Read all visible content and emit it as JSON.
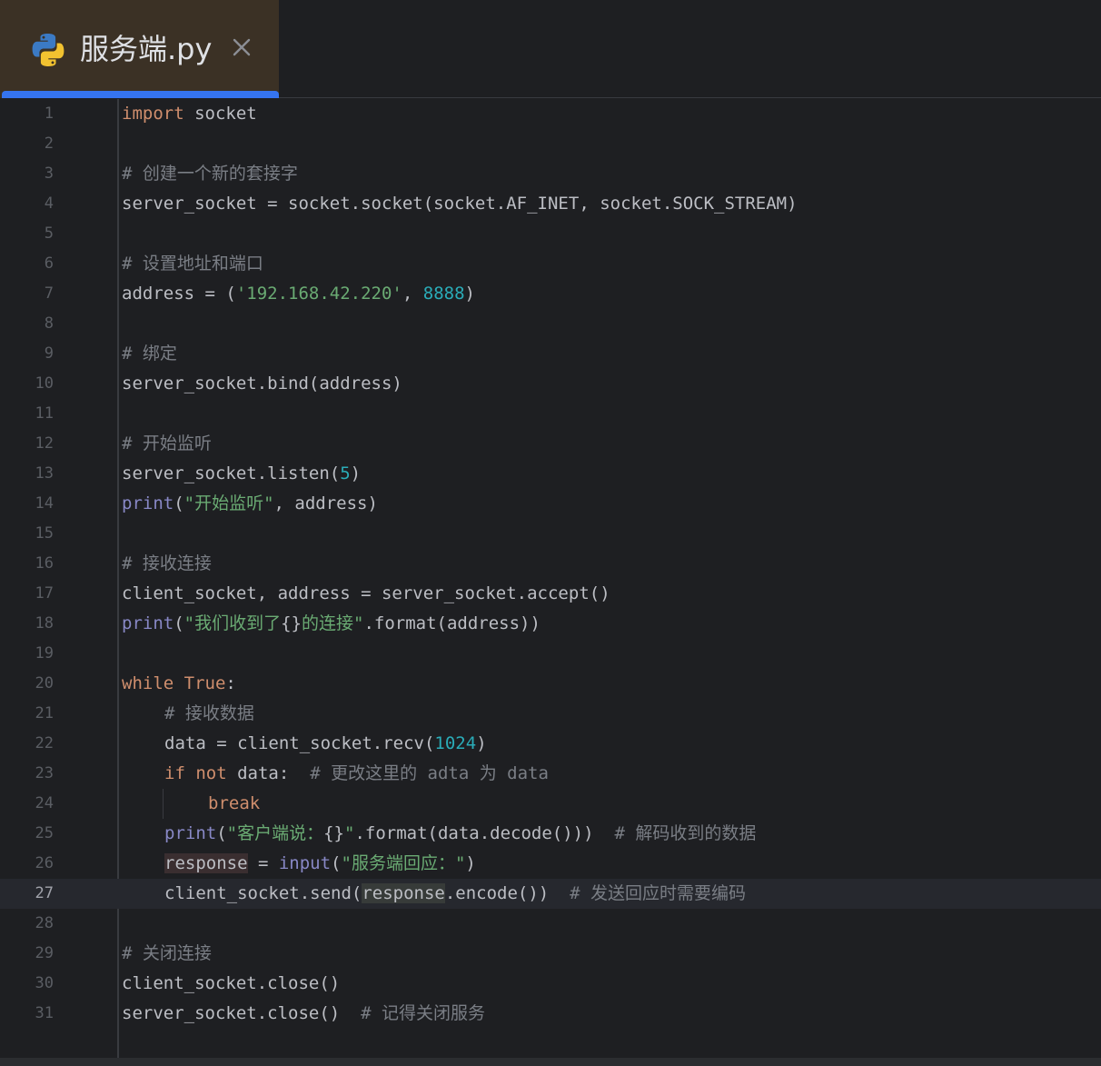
{
  "tab": {
    "title": "服务端.py",
    "icon": "python-icon",
    "close_icon": "close-icon",
    "accent": "#3574f0"
  },
  "editor": {
    "current_line": 27,
    "lines": [
      {
        "n": "1"
      },
      {
        "n": "2"
      },
      {
        "n": "3"
      },
      {
        "n": "4"
      },
      {
        "n": "5"
      },
      {
        "n": "6"
      },
      {
        "n": "7"
      },
      {
        "n": "8"
      },
      {
        "n": "9"
      },
      {
        "n": "10"
      },
      {
        "n": "11"
      },
      {
        "n": "12"
      },
      {
        "n": "13"
      },
      {
        "n": "14"
      },
      {
        "n": "15"
      },
      {
        "n": "16"
      },
      {
        "n": "17"
      },
      {
        "n": "18"
      },
      {
        "n": "19"
      },
      {
        "n": "20"
      },
      {
        "n": "21"
      },
      {
        "n": "22"
      },
      {
        "n": "23"
      },
      {
        "n": "24"
      },
      {
        "n": "25"
      },
      {
        "n": "26"
      },
      {
        "n": "27"
      },
      {
        "n": "28"
      },
      {
        "n": "29"
      },
      {
        "n": "30"
      },
      {
        "n": "31"
      }
    ],
    "code": {
      "l1": {
        "kw": "import",
        "rest": " socket"
      },
      "l3": {
        "cmt": "# 创建一个新的套接字"
      },
      "l4": {
        "text": "server_socket = socket.socket(socket.AF_INET, socket.SOCK_STREAM)"
      },
      "l6": {
        "cmt": "# 设置地址和端口"
      },
      "l7": {
        "a": "address = (",
        "str": "'192.168.42.220'",
        "b": ", ",
        "num": "8888",
        "c": ")"
      },
      "l9": {
        "cmt": "# 绑定"
      },
      "l10": {
        "text": "server_socket.bind(address)"
      },
      "l12": {
        "cmt": "# 开始监听"
      },
      "l13": {
        "a": "server_socket.listen(",
        "num": "5",
        "c": ")"
      },
      "l14": {
        "bi": "print",
        "a": "(",
        "str": "\"开始监听\"",
        "c": ", address)"
      },
      "l16": {
        "cmt": "# 接收连接"
      },
      "l17": {
        "text": "client_socket, address = server_socket.accept()"
      },
      "l18": {
        "bi": "print",
        "a": "(",
        "str1": "\"我们收到了",
        "brace": "{}",
        "str2": "的连接\"",
        "c": ".format(address))"
      },
      "l20": {
        "kw1": "while",
        "sp": " ",
        "kw2": "True",
        "c": ":"
      },
      "l21": {
        "cmt": "# 接收数据"
      },
      "l22": {
        "a": "data = client_socket.recv(",
        "num": "1024",
        "c": ")"
      },
      "l23": {
        "kw1": "if",
        "sp": " ",
        "kw2": "not",
        "a": " data:  ",
        "cmt": "# 更改这里的 adta 为 data"
      },
      "l24": {
        "kw": "break"
      },
      "l25": {
        "bi": "print",
        "a": "(",
        "str1": "\"客户端说：",
        "brace": "{}",
        "str2": "\"",
        "c": ".format(data.decode()))  ",
        "cmt": "# 解码收到的数据"
      },
      "l26": {
        "var": "response",
        "a": " = ",
        "bi": "input",
        "b": "(",
        "str": "\"服务端回应：\"",
        "c": ")"
      },
      "l27": {
        "a": "client_socket.send(",
        "var": "response",
        "c": ".encode())  ",
        "cmt": "# 发送回应时需要编码"
      },
      "l29": {
        "cmt": "# 关闭连接"
      },
      "l30": {
        "text": "client_socket.close()"
      },
      "l31": {
        "a": "server_socket.close()  ",
        "cmt": "# 记得关闭服务"
      }
    }
  }
}
